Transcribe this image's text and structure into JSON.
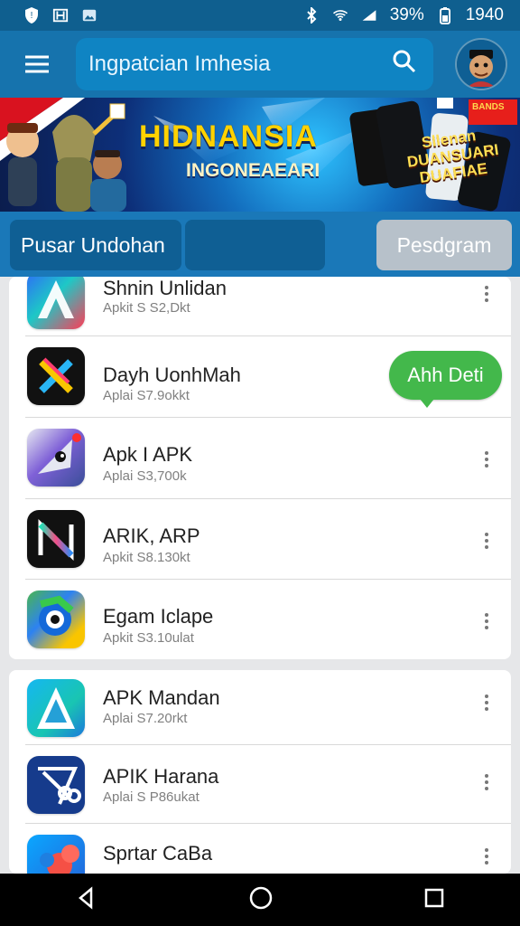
{
  "status_bar": {
    "left_icons": [
      "shield-alert-icon",
      "image-notification-icon",
      "gallery-notification-icon"
    ],
    "battery": "39%",
    "time": "1940"
  },
  "app_bar": {
    "search_text": "Ingpatcian Imhesia",
    "menu_icon": "menu-icon",
    "search_icon": "search-icon"
  },
  "banner": {
    "title": "HIDNANSIA",
    "subtitle": "INGONEAEARI",
    "badge_line1": "Sllenan",
    "badge_line2": "DUANSUARI",
    "badge_line3": "DUAFIAE",
    "top_right_text": "BANDS"
  },
  "tabs": {
    "active": "Pusar Undohan",
    "middle": "",
    "right": "Pesdgram"
  },
  "apps": [
    {
      "name": "Shnin Unlidan",
      "meta": "Apkit S S2,Dkt"
    },
    {
      "name": "Dayh UonhMah",
      "meta": "Aplai S7.9okkt"
    },
    {
      "name": "Apk I APK",
      "meta": "Aplai S3,700k"
    },
    {
      "name": "ARIK, ARP",
      "meta": "Apkit S8.130kt"
    },
    {
      "name": "Egam Iclape",
      "meta": "Apkit S3.10ulat"
    },
    {
      "name": "APK Mandan",
      "meta": "Aplai S7.20rkt"
    },
    {
      "name": "APIK Harana",
      "meta": "Aplai S P86ukat"
    },
    {
      "name": "Sprtar CaBa",
      "meta": ""
    }
  ],
  "apply_button": "Ahh Deti",
  "nav": [
    "back-icon",
    "home-icon",
    "recents-icon"
  ],
  "colors": {
    "status_bar": "#0f5f8f",
    "app_bar": "#1673ad",
    "apply": "#43b84b"
  }
}
